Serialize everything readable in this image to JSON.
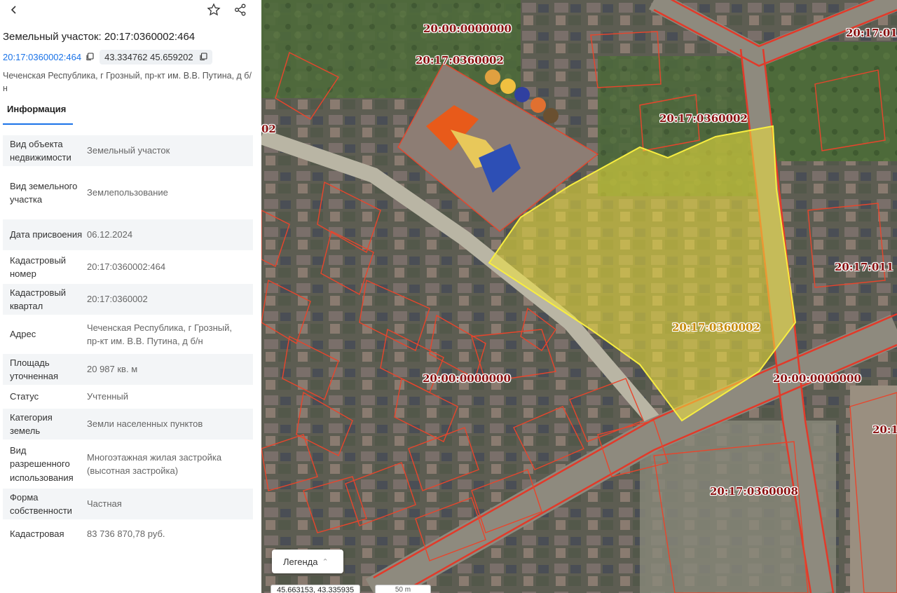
{
  "panel": {
    "title": "Земельный участок: 20:17:0360002:464",
    "cadastral_link": "20:17:0360002:464",
    "coords_chip": "43.334762 45.659202",
    "address": "Чеченская Республика, г Грозный, пр-кт им. В.В. Путина, д б/н",
    "tab_info": "Информация",
    "rows": [
      {
        "key": "Вид объекта недвижимости",
        "value": "Земельный участок"
      },
      {
        "key": "Вид земельного участка",
        "value": "Землепользование"
      },
      {
        "key": "Дата присвоения",
        "value": "06.12.2024"
      },
      {
        "key": "Кадастровый номер",
        "value": "20:17:0360002:464"
      },
      {
        "key": "Кадастровый квартал",
        "value": "20:17:0360002"
      },
      {
        "key": "Адрес",
        "value": "Чеченская Республика, г Грозный, пр-кт им. В.В. Путина, д б/н"
      },
      {
        "key": "Площадь уточненная",
        "value": "20 987 кв. м"
      },
      {
        "key": "Статус",
        "value": "Учтенный"
      },
      {
        "key": "Категория земель",
        "value": "Земли населенных пунктов"
      },
      {
        "key": "Вид разрешенного использования",
        "value": "Многоэтажная жилая застройка (высотная застройка)"
      },
      {
        "key": "Форма собственности",
        "value": "Частная"
      },
      {
        "key": "Кадастровая",
        "value": "83 736 870,78 руб."
      }
    ]
  },
  "map": {
    "labels": {
      "top_center": "20:00:0000000",
      "top_right": "20:17:01",
      "block_church": "20:17:0360002",
      "block_north": "20:17:0360002",
      "selected_parcel": "20:17:0360002",
      "road_left": "20:00:0000000",
      "road_right": "20:00:0000000",
      "right_edge": "20:17:011",
      "bottom_block": "20:17:0360008",
      "far_right": "20:1",
      "left_edge": "02"
    },
    "legend_label": "Легенда",
    "cursor_coords": "45.663153, 43.335935",
    "scale_label": "50 m",
    "colors": {
      "parcel_border": "#e8452c",
      "selected_fill": "#f3e33a",
      "road_red": "#e23a2a",
      "label_text": "#8a1010"
    }
  }
}
